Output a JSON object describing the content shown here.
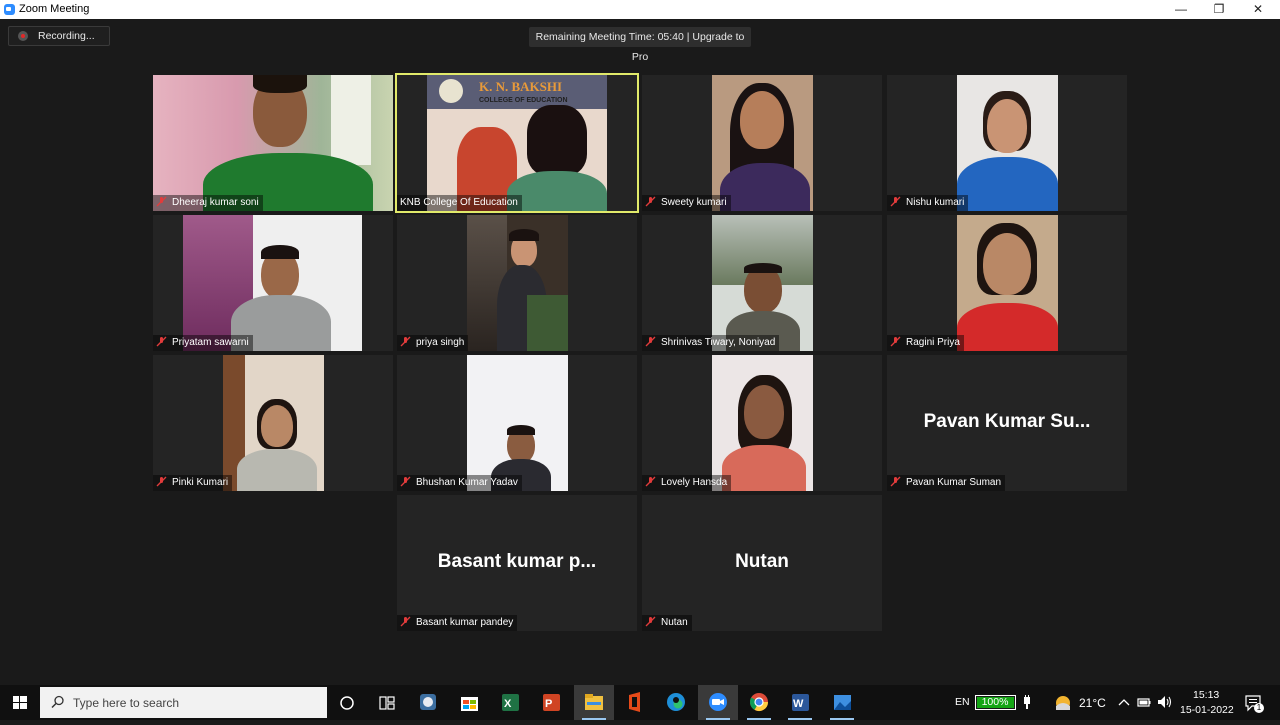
{
  "window": {
    "title": "Zoom Meeting",
    "controls": [
      "—",
      "❐",
      "✕"
    ]
  },
  "meeting": {
    "recording_label": "Recording...",
    "timer_text": "Remaining Meeting Time: 05:40 | Upgrade to Pro",
    "participants": [
      {
        "name": "Dheeraj kumar soni",
        "muted": true
      },
      {
        "name": "KNB College Of Education",
        "muted": false,
        "active_speaker": true,
        "banner_title": "K. N. BAKSHI",
        "banner_subtitle": "COLLEGE OF EDUCATION"
      },
      {
        "name": "Sweety kumari",
        "muted": true
      },
      {
        "name": "Nishu kumari",
        "muted": true
      },
      {
        "name": "Priyatam sawarni",
        "muted": true
      },
      {
        "name": "priya singh",
        "muted": true
      },
      {
        "name": "Shrinivas Tiwary, Noniyad",
        "muted": true
      },
      {
        "name": "Ragini  Priya",
        "muted": true
      },
      {
        "name": "Pinki Kumari",
        "muted": true
      },
      {
        "name": "Bhushan Kumar Yadav",
        "muted": true
      },
      {
        "name": "Lovely Hansda",
        "muted": true
      },
      {
        "name": "Pavan Kumar Suman",
        "muted": true,
        "display_name": "Pavan Kumar Su..."
      },
      {
        "name": "Basant kumar pandey",
        "muted": true,
        "display_name": "Basant kumar p..."
      },
      {
        "name": "Nutan",
        "muted": true,
        "display_name": "Nutan"
      }
    ]
  },
  "taskbar": {
    "search_placeholder": "Type here to search",
    "apps": [
      "cortana-icon",
      "task-view-icon",
      "vlc-icon",
      "store-icon",
      "excel-icon",
      "powerpoint-icon",
      "file-explorer-icon",
      "office-icon",
      "edge-icon",
      "zoom-icon",
      "chrome-icon",
      "word-icon",
      "photos-icon"
    ],
    "language": "EN",
    "battery_percent": "100%",
    "battery_level": 1.0,
    "temperature": "21°C",
    "time": "15:13",
    "date": "15-01-2022",
    "notification_count": "1",
    "colors": {
      "accent": "#2d8cff",
      "active_speaker_border": "#e1ea6a",
      "battery": "#14a514"
    }
  }
}
